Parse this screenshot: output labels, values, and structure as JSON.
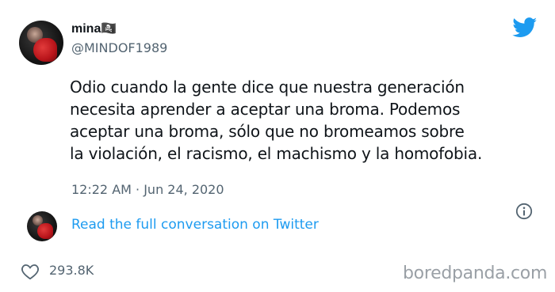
{
  "author": {
    "name": "mina🏴‍☠️",
    "handle": "@MINDOF1989"
  },
  "tweet": {
    "text": "Odio cuando la gente dice que nuestra generación\nnecesita aprender a aceptar una broma. Podemos\naceptar una broma, sólo que no bromeamos sobre\nla violación, el racismo, el machismo y la homofobia.",
    "timestamp": "12:22 AM · Jun 24, 2020"
  },
  "conversation": {
    "link_label": "Read the full conversation on Twitter"
  },
  "engagement": {
    "likes": "293.8K"
  },
  "watermark": "boredpanda.com",
  "colors": {
    "twitter_blue": "#1d9bf0",
    "secondary_text": "#536471",
    "watermark": "#9aa0a6"
  },
  "icons": {
    "brand": "twitter-bird-icon",
    "info": "info-icon",
    "like": "heart-icon"
  }
}
